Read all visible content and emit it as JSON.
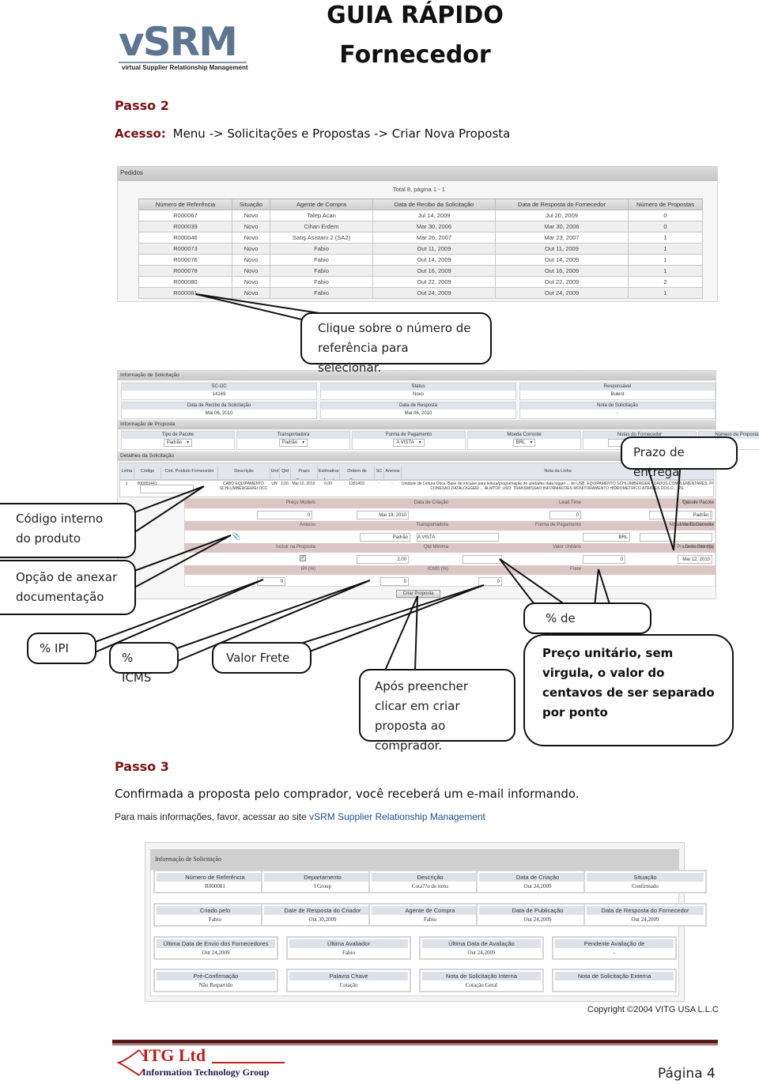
{
  "header": {
    "logo_word": "vSRM",
    "logo_subtitle": "virtual Supplier Relationship Management",
    "title_line1": "GUIA RÁPIDO",
    "title_line2": "Fornecedor"
  },
  "step2": {
    "title": "Passo 2",
    "access_label": "Acesso:",
    "access_path": "Menu -> Solicitações e Propostas -> Criar Nova Proposta"
  },
  "orders": {
    "panel_title": "Pedidos",
    "total_text": "Total 8, página 1 - 1",
    "columns": [
      "Número de Referência",
      "Situação",
      "Agente de Compra",
      "Data de Recibo da Solicitação",
      "Data de Resposta do Fornecedor",
      "Número de Propostas"
    ],
    "rows": [
      [
        "R000067",
        "Novo",
        "Talep Acan",
        "Jul 14, 2009",
        "Jul 20, 2009",
        "0"
      ],
      [
        "R000039",
        "Novo",
        "Cihan Erdem",
        "Mar 30, 2006",
        "Mar 30, 2006",
        "0"
      ],
      [
        "R000046",
        "Novo",
        "Satış Asistanı 2 (SA2)",
        "Mar 26, 2007",
        "Mar 23, 2007",
        "1"
      ],
      [
        "R000073",
        "Novo",
        "Fabio",
        "Out 11, 2009",
        "Out 11, 2009",
        "1"
      ],
      [
        "R000076",
        "Novo",
        "Fabio",
        "Out 14, 2009",
        "Out 14, 2009",
        "1"
      ],
      [
        "R000078",
        "Novo",
        "Fabio",
        "Out 16, 2009",
        "Out 16, 2009",
        "1"
      ],
      [
        "R000080",
        "Novo",
        "Fabio",
        "Out 22, 2009",
        "Out 22, 2009",
        "2"
      ],
      [
        "R000081",
        "Novo",
        "Fabio",
        "Out 24, 2009",
        "Out 24, 2009",
        "1"
      ]
    ]
  },
  "proposal": {
    "info_title": "Informação de Solicitação",
    "info_cells": [
      {
        "label": "SC-OC",
        "value": "14169"
      },
      {
        "label": "Status",
        "value": "Novo"
      },
      {
        "label": "Responsável",
        "value": "Bulent"
      },
      {
        "label": "Data de Recibo da Solicitação",
        "value": "Mai 06, 2010"
      },
      {
        "label": "Data de Resposta",
        "value": "Mai 06, 2010"
      },
      {
        "label": "Nota de Solicitação",
        "value": "-"
      }
    ],
    "proposal_title": "Informação de Proposta",
    "proposal_cells": [
      {
        "label": "Tipo de Pacote",
        "value": "Padrão"
      },
      {
        "label": "Transportadora",
        "value": "Padrão"
      },
      {
        "label": "Forma de Pagamento",
        "value": "A VISTA"
      },
      {
        "label": "Moeda Corrente",
        "value": "BRL"
      },
      {
        "label": "Notas do Fornecedor",
        "value": ""
      },
      {
        "label": "Número da Proposta",
        "value": ""
      }
    ],
    "details_title": "Detalhes da Solicitação",
    "detail_columns": [
      "Linha",
      "Código",
      "Cód. Produto Fornecedor",
      "Descrição",
      "Und",
      "Qtd",
      "Prazo Entrega",
      "Estimativa Anual",
      "Ordem de Compra",
      "SC",
      "Anexos",
      "Nota da Linha"
    ],
    "detail_row": {
      "linha": "1",
      "codigo": "000003441",
      "cod_fornecedor": "",
      "descricao": "CABO EQUIPAMENTO SCHLUMBERGER/EI DCC",
      "und": "UN",
      "qtd": "2,00",
      "prazo": "Mai 12, 2010",
      "estimativa": "0,00",
      "ordem": "1281403",
      "sc": "-",
      "anexos": "-",
      "nota": "Unidade de Leitura Ótica. Base de encaixe para leitura/programação de unidades data logger ... ão USB. EQUIPAMENTO SCHLUMBERGER - DADOS COMPLEMENTARES: P/ CONEXAO DATALOGGER/ ... ALMTOP, USO: TRANSMISSAO INFORMACOES MONITORAMENTO HIDROMETRICO ATRAVES DOS D... RS."
    },
    "line_form": {
      "preco_modelo_label": "Preço Modelo",
      "preco_modelo": "0",
      "data_criacao_label": "Data de Criação",
      "data_criacao": "Mai 19, 2010",
      "lead_time_label": "Lead Time",
      "lead_time": "0",
      "qtd_pacote_label": "Qtd em Pacote",
      "qtd_pacote": "1",
      "tipo_pacote_label": "Tipo de Pacote",
      "tipo_pacote": "Padrão",
      "anexos_label": "Anexos",
      "transportadora_label": "Transportadora",
      "transportadora": "Padrão",
      "forma_pagamento_label": "Forma de Pagamento",
      "forma_pagamento": "A VISTA",
      "moeda_label": "Moeda Corrente",
      "moeda": "BRL",
      "notas_fornecedor_label": "Notas do Fornecedor",
      "incluir_label": "Incluir na Proposta",
      "incluir_checked": true,
      "qtd_minima_label": "Qtd Mínima",
      "qtd_minima": "2.00",
      "valor_unitario_label": "Valor Unitário",
      "valor_unitario": "",
      "desconto_label": "Desconto (%)",
      "desconto": "0",
      "prazo_entrega_label": "Prazo de Entrega",
      "prazo_entrega": "Mai 12, 2010",
      "ipi_label": "IPI (%)",
      "ipi": "0",
      "icms_label": "ICMS (%)",
      "icms": "0",
      "frete_label": "Frete",
      "frete": "0"
    },
    "create_button": "Criar Proposta"
  },
  "callouts": {
    "click_reference": "Clique sobre o número de referência para selecionar.",
    "prazo": "Prazo de entrega",
    "codigo": "Código interno do produto",
    "anexar": "Opção de anexar documentação",
    "desconto": "% de desconto",
    "ipi": "% IPI",
    "icms": "% ICMS",
    "frete": "Valor Frete",
    "criar": "Após preencher clicar em criar proposta ao comprador.",
    "preco": "Preço unitário, sem virgula, o valor do centavos de ser separado por ponto"
  },
  "step3": {
    "title": "Passo 3",
    "text": "Confirmada a proposta pelo comprador, você receberá um e-mail informando.",
    "more_info": "Para mais informações, favor, acessar ao site ",
    "link_text": "vSRM Supplier Relationship Management"
  },
  "summary": {
    "panel_title": "Informação de Solicitação",
    "cards": [
      {
        "label": "Número de Referência",
        "value": "R000081"
      },
      {
        "label": "Departamento",
        "value": "I Group"
      },
      {
        "label": "Descrição",
        "value": "Cota??o de itens"
      },
      {
        "label": "Data de Criação",
        "value": "Out 24,2009"
      },
      {
        "label": "Situação",
        "value": "Confirmado"
      },
      {
        "label": "Criado pelo",
        "value": "Fabio"
      },
      {
        "label": "Date de Resposta do Criador",
        "value": "Out 30,2009"
      },
      {
        "label": "Agente de Compra",
        "value": "Fabio"
      },
      {
        "label": "Data de Publicação",
        "value": "Out 24,2009"
      },
      {
        "label": "Data de Resposta do Fornecedor",
        "value": "Out 24,2009"
      },
      {
        "label": "Última Data de Envio dos Fornecedores",
        "value": "Out 24,2009"
      },
      {
        "label": "Última Avaliador",
        "value": "Fabio"
      },
      {
        "label": "Última Data de Avaliação",
        "value": "Out 24,2009"
      },
      {
        "label": "Pendente Avaliação de",
        "value": "-"
      },
      {
        "label": "Pré-Confirmação",
        "value": "Não Requerido"
      },
      {
        "label": "Palavra Chave",
        "value": "Cotação"
      },
      {
        "label": "Nota de Solicitação Interna",
        "value": "Cotação Geral"
      },
      {
        "label": "Nota de Solicitação Externa",
        "value": ""
      }
    ],
    "copyright": "Copyright ©2004 VITG USA L.L.C"
  },
  "footer": {
    "company": "ITG Ltd",
    "company_sub": "Information Technology Group",
    "page": "Página 4"
  },
  "colors": {
    "step_title": "#7a1212",
    "link": "#1f4e8c",
    "footer_bar": "#5a1a1a"
  }
}
